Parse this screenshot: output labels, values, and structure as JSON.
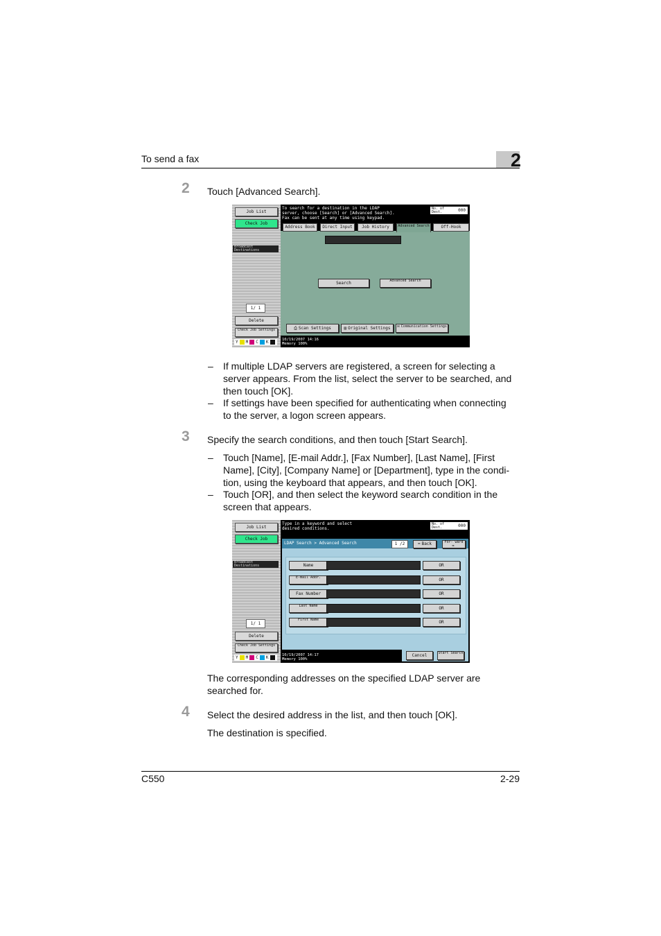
{
  "header": {
    "title": "To send a fax",
    "chapter": "2"
  },
  "steps": [
    {
      "number": "2",
      "text": "Touch [Advanced Search]."
    },
    {
      "number": "3",
      "text": "Specify the search conditions, and then touch [Start Search]."
    },
    {
      "number": "4",
      "text": "Select the desired address in the list, and then touch [OK]."
    }
  ],
  "bullets_step2": [
    {
      "lines": [
        "If multiple LDAP servers are registered, a screen for selecting a",
        "server appears. From the list, select the server to be searched, and",
        "then touch [OK]."
      ]
    },
    {
      "lines": [
        "If settings have been specified for authenticating when connecting",
        "to the server, a logon screen appears."
      ]
    }
  ],
  "bullets_step3": [
    {
      "lines": [
        "Touch [Name], [E-mail Addr.], [Fax Number], [Last Name], [First",
        "Name], [City], [Company Name] or [Department], type in the condi-",
        "tion, using the keyboard that appears, and then touch [OK]."
      ]
    },
    {
      "lines": [
        "Touch [OR], and then select the keyword search condition in the",
        "screen that appears."
      ]
    }
  ],
  "result_step3": [
    "The corresponding addresses on the specified LDAP server are",
    "searched for."
  ],
  "result_step4": "The destination is specified.",
  "footer": {
    "model": "C550",
    "page": "2-29"
  },
  "screen1": {
    "left": {
      "job_list": "Job List",
      "check_job": "Check Job",
      "destinations": "Broadcast Destinations",
      "page": "1/ 1",
      "delete": "Delete",
      "check_job_settings": "Check Job Settings",
      "toners": [
        "Y",
        "M",
        "C",
        "K"
      ]
    },
    "message": [
      "To search for a destination in the LDAP",
      "server, choose [Search] or [Advanced Search].",
      "Fax can be sent at any time using keypad."
    ],
    "memory": {
      "label": "No. of Dest.",
      "value": "000"
    },
    "tabs": [
      "Address Book",
      "Direct Input",
      "Job History",
      "Advanced Search",
      "Off-Hook"
    ],
    "buttons": {
      "search": "Search",
      "advanced": "Advanced Search"
    },
    "bottom": [
      "Scan Settings",
      "Original Settings",
      "Communication Settings"
    ],
    "status": {
      "date": "10/19/2007",
      "time": "14:16",
      "memory": "Memory",
      "pct": "100%"
    }
  },
  "screen2": {
    "left": {
      "job_list": "Job List",
      "check_job": "Check Job",
      "destinations": "Broadcast Destinations",
      "page": "1/ 1",
      "delete": "Delete",
      "check_job_settings": "Check Job Settings",
      "toners": [
        "Y",
        "M",
        "C",
        "K"
      ]
    },
    "message": [
      "Type in a keyword and select",
      "desired conditions."
    ],
    "memory": {
      "label": "No. of Dest.",
      "value": "000"
    },
    "breadcrumb": "LDAP Search > Advanced Search",
    "page": "1 /2",
    "back": "Back",
    "forward": "For- ward",
    "rows": [
      "Name",
      "E-mail Addr.",
      "Fax Number",
      "Last Name",
      "First Name"
    ],
    "or_label": "OR",
    "cancel": "Cancel",
    "start": "Start Search",
    "status": {
      "date": "10/19/2007",
      "time": "14:17",
      "memory": "Memory",
      "pct": "100%"
    }
  },
  "colors": {
    "screen_bg": "#86ab9a",
    "ldap_panel": "#a9cfe0",
    "green_button": "#2fe58c"
  }
}
